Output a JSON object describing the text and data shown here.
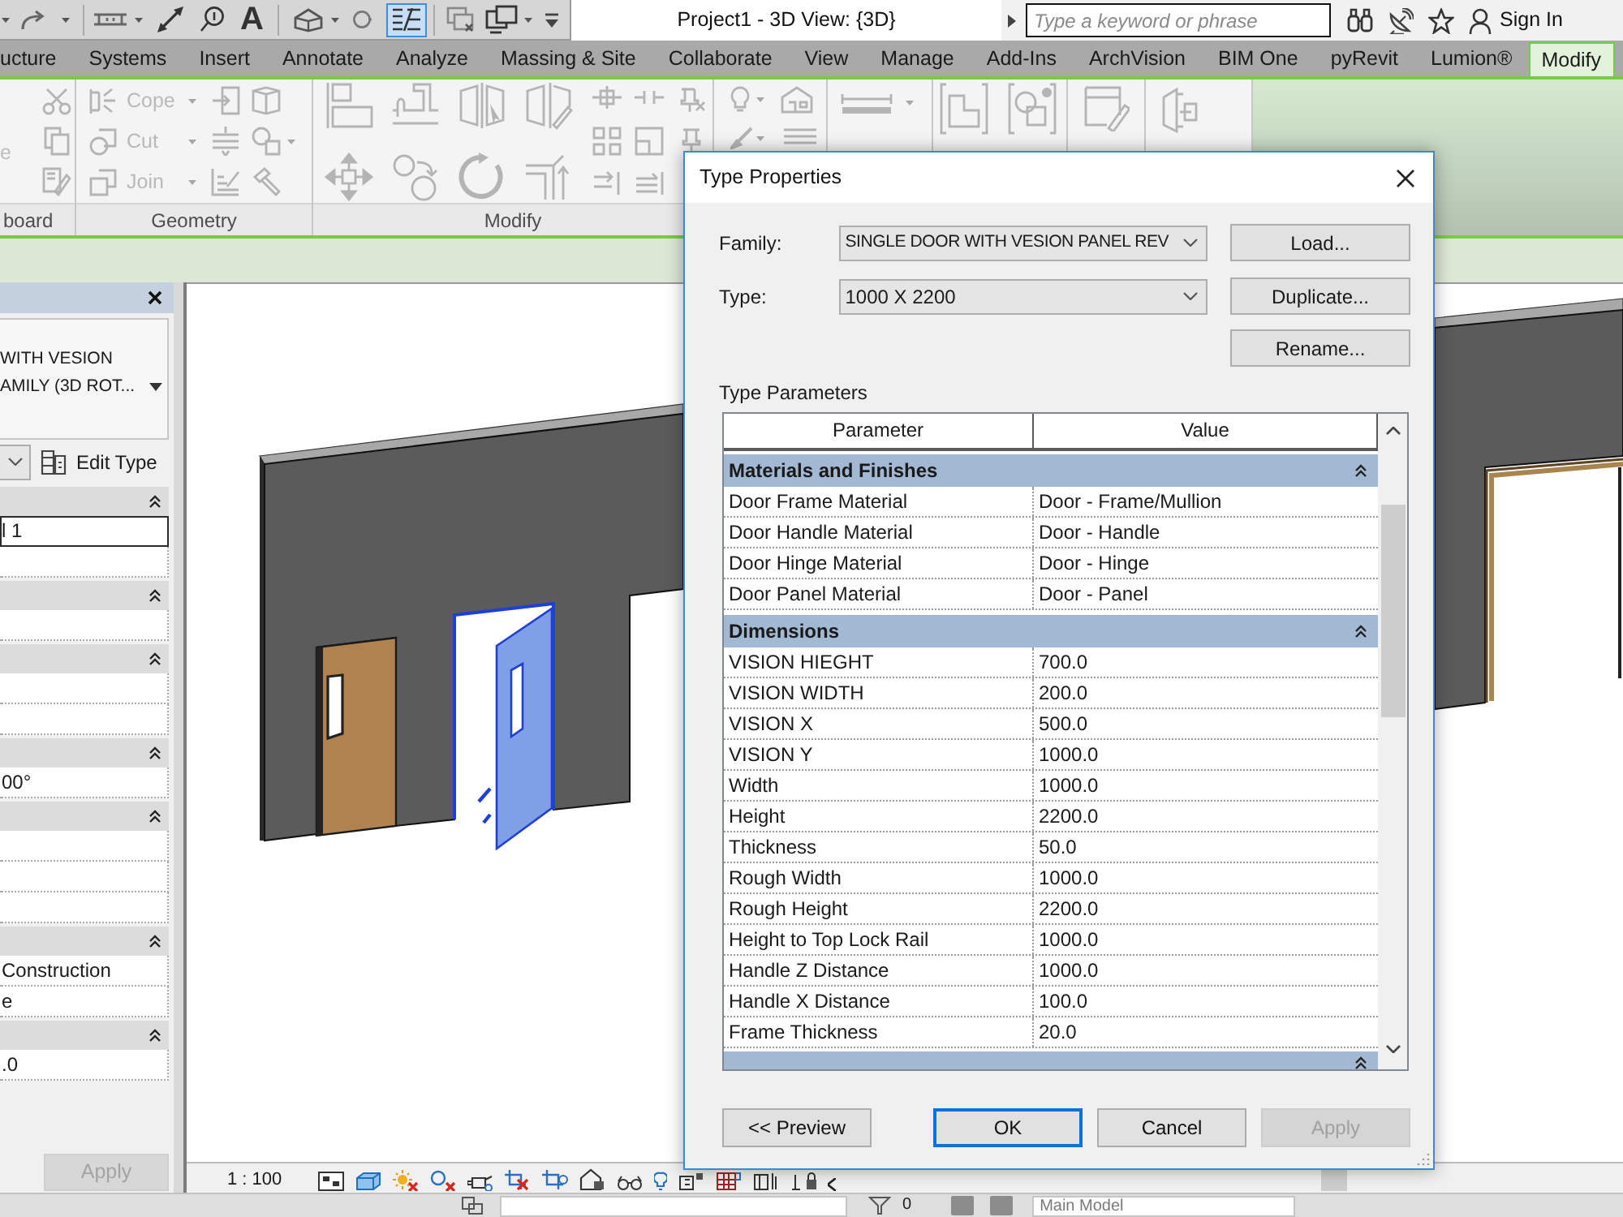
{
  "quick_access": {
    "text_tool": "A",
    "thin_lines_on": true
  },
  "title": "Project1 - 3D View: {3D}",
  "search": {
    "placeholder": "Type a keyword or phrase"
  },
  "sign_in": "Sign In",
  "tabs": [
    {
      "label": "ucture",
      "selected": false
    },
    {
      "label": "Systems",
      "selected": false
    },
    {
      "label": "Insert",
      "selected": false
    },
    {
      "label": "Annotate",
      "selected": false
    },
    {
      "label": "Analyze",
      "selected": false
    },
    {
      "label": "Massing & Site",
      "selected": false
    },
    {
      "label": "Collaborate",
      "selected": false
    },
    {
      "label": "View",
      "selected": false
    },
    {
      "label": "Manage",
      "selected": false
    },
    {
      "label": "Add-Ins",
      "selected": false
    },
    {
      "label": "ArchVision",
      "selected": false
    },
    {
      "label": "BIM One",
      "selected": false
    },
    {
      "label": "pyRevit",
      "selected": false
    },
    {
      "label": "Lumion®",
      "selected": false
    },
    {
      "label": "Modify",
      "selected": true
    }
  ],
  "ribbon": {
    "clipboard": {
      "label": "board",
      "tool_fragment": "e"
    },
    "geometry": {
      "label": "Geometry",
      "tools": [
        "Cope",
        "Cut",
        "Join"
      ]
    },
    "modify": {
      "label": "Modify"
    }
  },
  "properties": {
    "type_name": [
      "WITH VESION",
      "AMILY (3D ROT..."
    ],
    "edit_type": "Edit Type",
    "sections": [
      {
        "expanded": true,
        "rows": [
          {
            "kind": "field",
            "value": "l 1"
          },
          {
            "kind": "blank"
          }
        ]
      },
      {
        "expanded": true,
        "rows": [
          {
            "kind": "blank"
          }
        ]
      },
      {
        "expanded": true,
        "rows": [
          {
            "kind": "blank"
          },
          {
            "kind": "blank"
          }
        ]
      },
      {
        "expanded": true,
        "rows": [
          {
            "kind": "text",
            "value": "00°"
          }
        ]
      },
      {
        "expanded": true,
        "rows": [
          {
            "kind": "blank"
          },
          {
            "kind": "blank"
          },
          {
            "kind": "blank"
          }
        ]
      },
      {
        "expanded": true,
        "rows": [
          {
            "kind": "text",
            "value": "Construction"
          },
          {
            "kind": "text",
            "value": "e"
          }
        ]
      },
      {
        "expanded": true,
        "rows": [
          {
            "kind": "text",
            "value": ".0"
          }
        ]
      }
    ],
    "apply": {
      "label": "Apply",
      "disabled": true
    }
  },
  "view": {
    "doors": [
      {
        "selected": false
      },
      {
        "selected": true
      }
    ],
    "scale": "1 : 100"
  },
  "dialog": {
    "title": "Type Properties",
    "family_label": "Family:",
    "family": "SINGLE DOOR WITH VESION PANEL REV",
    "type_label": "Type:",
    "type": "1000 X 2200",
    "side_buttons": [
      "Load...",
      "Duplicate...",
      "Rename..."
    ],
    "parameters_label": "Type Parameters",
    "columns": [
      "Parameter",
      "Value"
    ],
    "groups": [
      {
        "name": "Materials and Finishes",
        "expanded": true,
        "rows": [
          {
            "parameter": "Door Frame Material",
            "value": "Door - Frame/Mullion"
          },
          {
            "parameter": "Door Handle Material",
            "value": "Door - Handle"
          },
          {
            "parameter": "Door Hinge Material",
            "value": "Door - Hinge"
          },
          {
            "parameter": "Door Panel Material",
            "value": "Door - Panel"
          }
        ]
      },
      {
        "name": "Dimensions",
        "expanded": true,
        "rows": [
          {
            "parameter": "VISION HIEGHT",
            "value": "700.0"
          },
          {
            "parameter": "VISION WIDTH",
            "value": "200.0"
          },
          {
            "parameter": "VISION X",
            "value": "500.0"
          },
          {
            "parameter": "VISION Y",
            "value": "1000.0"
          },
          {
            "parameter": "Width",
            "value": "1000.0"
          },
          {
            "parameter": "Height",
            "value": "2200.0"
          },
          {
            "parameter": "Thickness",
            "value": "50.0"
          },
          {
            "parameter": "Rough Width",
            "value": "1000.0"
          },
          {
            "parameter": "Rough Height",
            "value": "2200.0"
          },
          {
            "parameter": "Height to Top Lock Rail",
            "value": "1000.0"
          },
          {
            "parameter": "Handle Z Distance",
            "value": "1000.0"
          },
          {
            "parameter": "Handle X Distance",
            "value": "100.0"
          },
          {
            "parameter": "Frame Thickness",
            "value": "20.0"
          }
        ]
      },
      {
        "expanded": true
      }
    ],
    "buttons": [
      {
        "label": "<< Preview",
        "focused": false,
        "disabled": false
      },
      {
        "label": "OK",
        "focused": true,
        "disabled": false
      },
      {
        "label": "Cancel",
        "focused": false,
        "disabled": false
      },
      {
        "label": "Apply",
        "focused": false,
        "disabled": true
      }
    ]
  },
  "status_bar": {
    "count": "0",
    "model": "Main Model"
  }
}
